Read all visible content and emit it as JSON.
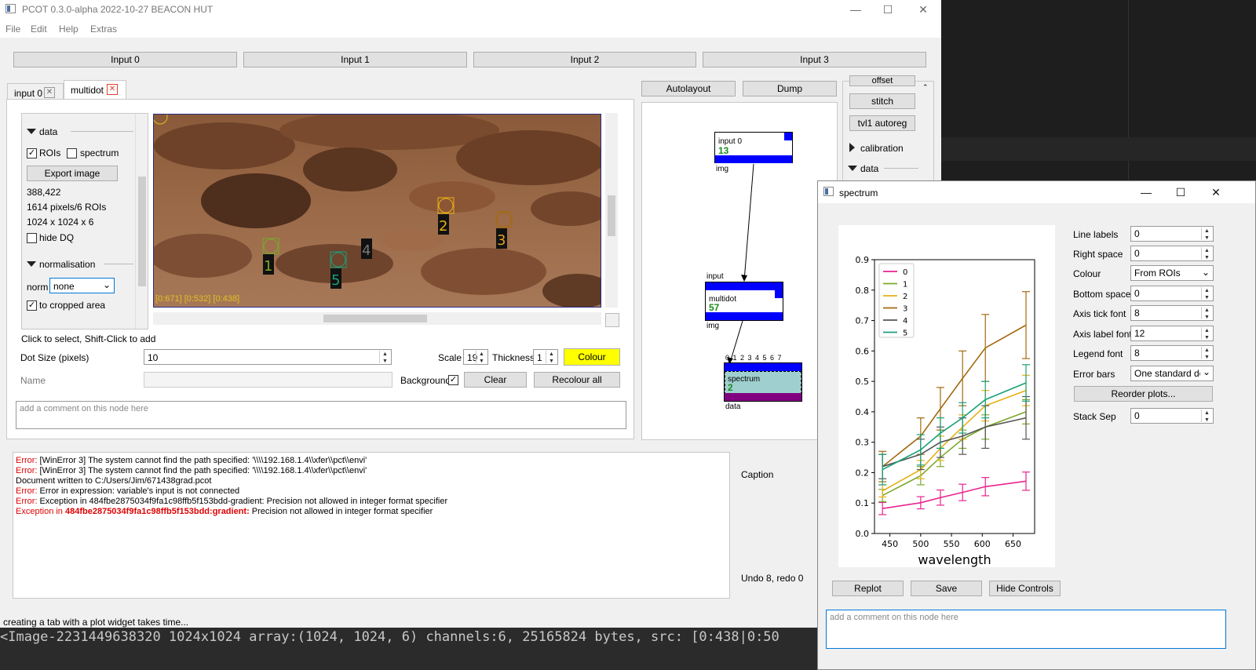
{
  "window": {
    "title": "PCOT 0.3.0-alpha 2022-10-27 BEACON HUT"
  },
  "menu": [
    "File",
    "Edit",
    "Help",
    "Extras"
  ],
  "inputs": [
    "Input 0",
    "Input 1",
    "Input 2",
    "Input 3"
  ],
  "tabs": [
    {
      "label": "input 0"
    },
    {
      "label": "multidot"
    }
  ],
  "graph_buttons": {
    "autolayout": "Autolayout",
    "dump": "Dump"
  },
  "palette": {
    "offset": "offset",
    "stitch": "stitch",
    "tvl1": "tvl1 autoreg",
    "calibration": "calibration",
    "data": "data"
  },
  "canvas": {
    "data_section": "data",
    "rois_label": "ROIs",
    "spectrum_label": "spectrum",
    "export_button": "Export image",
    "coords": "388,422",
    "pixels": "1614 pixels/6 ROIs",
    "dims": "1024 x 1024 x 6",
    "hide_dq": "hide DQ",
    "normalisation_section": "normalisation",
    "norm_label": "norm",
    "norm_value": "none",
    "cropped_label": "to cropped area",
    "coord_overlay": "[0:671] [0:532] [0:438]",
    "roi_labels": [
      "1",
      "2",
      "3",
      "4",
      "5"
    ]
  },
  "multidot": {
    "hint": "Click to select, Shift-Click to add",
    "dot_size_label": "Dot Size (pixels)",
    "dot_size_value": "10",
    "scale_label": "Scale",
    "scale_value": "19",
    "thickness_label": "Thickness",
    "thickness_value": "1",
    "colour_button": "Colour",
    "name_label": "Name",
    "background_label": "Background",
    "clear_button": "Clear",
    "recolour_button": "Recolour all",
    "comment_placeholder": "add a comment on this node here"
  },
  "graph": {
    "input0": {
      "name": "input 0",
      "value": "13",
      "out": "img"
    },
    "multidot": {
      "in": "input",
      "name": "multidot",
      "value": "57",
      "out": "img"
    },
    "spectrum": {
      "ports": "0 1 2 3 4 5 6 7",
      "name": "spectrum",
      "value": "2",
      "out": "data"
    }
  },
  "log": [
    {
      "prefix": "Error:",
      "text": " [WinError 3] The system cannot find the path specified: '\\\\\\\\192.168.1.4\\\\xfer\\\\pct\\\\envi'"
    },
    {
      "prefix": "Error:",
      "text": " [WinError 3] The system cannot find the path specified: '\\\\\\\\192.168.1.4\\\\xfer\\\\pct\\\\envi'"
    },
    {
      "prefix": "",
      "text": "Document written to C:/Users/Jim/671438grad.pcot"
    },
    {
      "prefix": "Error:",
      "text": " Error in expression: variable's input is not connected"
    },
    {
      "prefix": "Error:",
      "text": " Exception in 484fbe2875034f9fa1c98ffb5f153bdd-gradient: Precision not allowed in integer format specifier"
    }
  ],
  "log_last": {
    "prefix": "Exception in ",
    "bold": "484fbe2875034f9fa1c98ffb5f153bdd:gradient:",
    "text": " Precision not allowed in integer format specifier"
  },
  "caption_label": "Caption",
  "undo_label": "Undo 8, redo 0",
  "status_message": "creating a tab with a plot widget takes time...",
  "status_bar": "<Image-2231449638320 1024x1024 array:(1024, 1024, 6) channels:6, 25165824 bytes, src: [0:438|0:50",
  "spectrum_window": {
    "title": "spectrum",
    "controls": {
      "line_labels": {
        "label": "Line labels",
        "value": "0"
      },
      "right_space": {
        "label": "Right space",
        "value": "0"
      },
      "colour": {
        "label": "Colour",
        "value": "From ROIs"
      },
      "bottom_space": {
        "label": "Bottom space",
        "value": "0"
      },
      "axis_tick_font": {
        "label": "Axis tick font",
        "value": "8"
      },
      "axis_label_font": {
        "label": "Axis label font",
        "value": "12"
      },
      "legend_font": {
        "label": "Legend font",
        "value": "8"
      },
      "error_bars": {
        "label": "Error bars",
        "value": "One standard dev"
      },
      "reorder": "Reorder plots...",
      "stack_sep": {
        "label": "Stack Sep",
        "value": "0"
      }
    },
    "buttons": {
      "replot": "Replot",
      "save": "Save",
      "hide": "Hide Controls"
    },
    "comment_placeholder": "add a comment on this node here"
  },
  "colors": {
    "selected_node": "#0000ff",
    "colour_button": "#ffff00",
    "spectrum_out": "#800080"
  },
  "chart_data": {
    "type": "line",
    "xlabel": "wavelength",
    "ylabel": "",
    "xlim": [
      425,
      685
    ],
    "ylim": [
      0.0,
      0.9
    ],
    "xticks": [
      450,
      500,
      550,
      600,
      650
    ],
    "yticks": [
      "0.0",
      "0.1",
      "0.2",
      "0.3",
      "0.4",
      "0.5",
      "0.6",
      "0.7",
      "0.8",
      "0.9"
    ],
    "legend": "top-left",
    "x": [
      438,
      500,
      532,
      568,
      605,
      671
    ],
    "series": [
      {
        "name": "0",
        "color": "#e8238f",
        "values": [
          0.082,
          0.101,
          0.118,
          0.135,
          0.154,
          0.172
        ],
        "err": [
          0.02,
          0.02,
          0.025,
          0.027,
          0.03,
          0.03
        ]
      },
      {
        "name": "1",
        "color": "#7aa92a",
        "values": [
          0.125,
          0.19,
          0.25,
          0.31,
          0.35,
          0.4
        ],
        "err": [
          0.02,
          0.03,
          0.03,
          0.03,
          0.04,
          0.04
        ]
      },
      {
        "name": "2",
        "color": "#e8b015",
        "values": [
          0.14,
          0.21,
          0.28,
          0.35,
          0.42,
          0.47
        ],
        "err": [
          0.02,
          0.03,
          0.04,
          0.04,
          0.05,
          0.05
        ]
      },
      {
        "name": "3",
        "color": "#a36a10",
        "values": [
          0.22,
          0.32,
          0.41,
          0.51,
          0.61,
          0.685
        ],
        "err": [
          0.05,
          0.06,
          0.07,
          0.09,
          0.11,
          0.11
        ]
      },
      {
        "name": "4",
        "color": "#555555",
        "values": [
          0.22,
          0.26,
          0.3,
          0.32,
          0.35,
          0.38
        ],
        "err": [
          0.04,
          0.05,
          0.05,
          0.06,
          0.07,
          0.07
        ]
      },
      {
        "name": "5",
        "color": "#19a07a",
        "values": [
          0.21,
          0.275,
          0.33,
          0.38,
          0.44,
          0.495
        ],
        "err": [
          0.05,
          0.05,
          0.05,
          0.05,
          0.06,
          0.06
        ]
      }
    ]
  }
}
